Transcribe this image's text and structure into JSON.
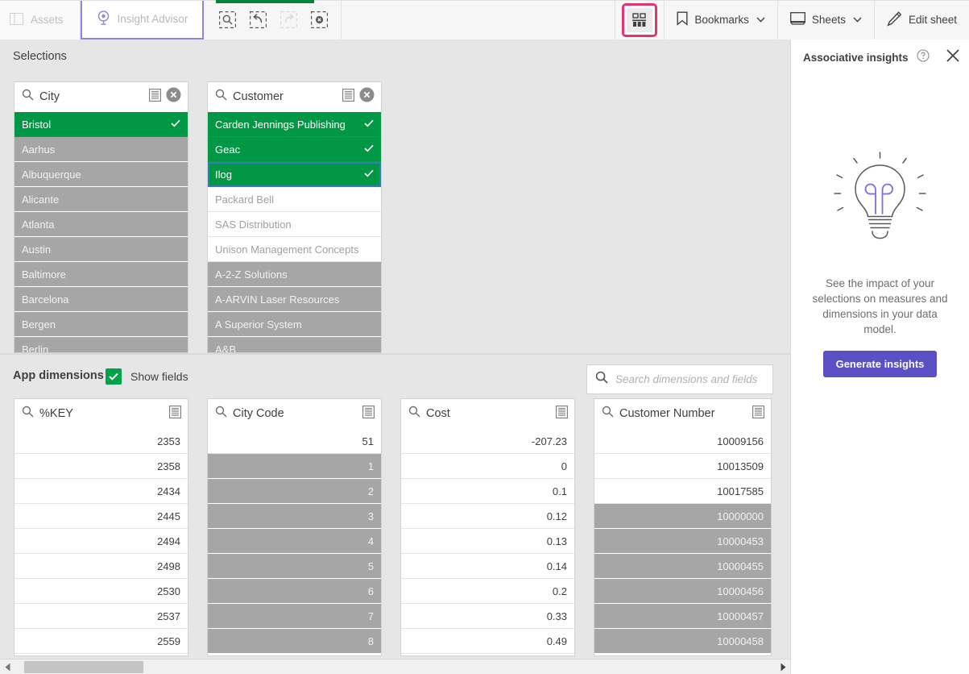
{
  "toolbar": {
    "assets_label": "Assets",
    "insight_advisor_label": "Insight Advisor",
    "icons": [
      "selection-search-icon",
      "step-back-icon",
      "step-forward-icon",
      "clear-all-selections-icon"
    ],
    "associative_insights_label": "Associative insights toggle",
    "bookmarks_label": "Bookmarks",
    "sheets_label": "Sheets",
    "edit_sheet_label": "Edit sheet",
    "chevron": "⌄",
    "highlight_color": "#e6336b",
    "accent_green": "#00873d",
    "insight_tab_border": "#8e86d6"
  },
  "selections": {
    "title": "Selections",
    "colors": {
      "selected": "#009845",
      "excluded": "#a6a6a6",
      "focus": "#3b7ab5"
    },
    "listboxes": [
      {
        "field": "City",
        "has_clear": true,
        "align": "left",
        "rows": [
          {
            "value": "Bristol",
            "state": "selected",
            "check": true
          },
          {
            "value": "Aarhus",
            "state": "excluded"
          },
          {
            "value": "Albuquerque",
            "state": "excluded"
          },
          {
            "value": "Alicante",
            "state": "excluded"
          },
          {
            "value": "Atlanta",
            "state": "excluded"
          },
          {
            "value": "Austin",
            "state": "excluded"
          },
          {
            "value": "Baltimore",
            "state": "excluded"
          },
          {
            "value": "Barcelona",
            "state": "excluded"
          },
          {
            "value": "Bergen",
            "state": "excluded"
          },
          {
            "value": "Berlin",
            "state": "excluded"
          }
        ]
      },
      {
        "field": "Customer",
        "has_clear": true,
        "align": "left",
        "rows": [
          {
            "value": "Carden Jennings Publishing",
            "state": "selected",
            "check": true
          },
          {
            "value": "Geac",
            "state": "selected",
            "check": true
          },
          {
            "value": "Ilog",
            "state": "selected",
            "check": true,
            "focused": true
          },
          {
            "value": "Packard Bell",
            "state": "alt"
          },
          {
            "value": "SAS Distribution",
            "state": "alt"
          },
          {
            "value": "Unison Management Concepts",
            "state": "alt"
          },
          {
            "value": "A-2-Z Solutions",
            "state": "excluded"
          },
          {
            "value": "A-ARVIN Laser Resources",
            "state": "excluded"
          },
          {
            "value": "A Superior System",
            "state": "excluded"
          },
          {
            "value": "A&B",
            "state": "excluded"
          }
        ]
      }
    ]
  },
  "app_dimensions": {
    "title": "App dimensions",
    "show_fields_label": "Show fields",
    "show_fields_checked": true,
    "search_placeholder": "Search dimensions and fields",
    "search_value": "",
    "listboxes": [
      {
        "field": "%KEY",
        "has_clear": false,
        "align": "right",
        "rows": [
          {
            "value": "2353",
            "state": "possible"
          },
          {
            "value": "2358",
            "state": "possible"
          },
          {
            "value": "2434",
            "state": "possible"
          },
          {
            "value": "2445",
            "state": "possible"
          },
          {
            "value": "2494",
            "state": "possible"
          },
          {
            "value": "2498",
            "state": "possible"
          },
          {
            "value": "2530",
            "state": "possible"
          },
          {
            "value": "2537",
            "state": "possible"
          },
          {
            "value": "2559",
            "state": "possible"
          }
        ]
      },
      {
        "field": "City Code",
        "has_clear": false,
        "align": "right",
        "rows": [
          {
            "value": "51",
            "state": "possible"
          },
          {
            "value": "1",
            "state": "excluded"
          },
          {
            "value": "2",
            "state": "excluded"
          },
          {
            "value": "3",
            "state": "excluded"
          },
          {
            "value": "4",
            "state": "excluded"
          },
          {
            "value": "5",
            "state": "excluded"
          },
          {
            "value": "6",
            "state": "excluded"
          },
          {
            "value": "7",
            "state": "excluded"
          },
          {
            "value": "8",
            "state": "excluded"
          }
        ]
      },
      {
        "field": "Cost",
        "has_clear": false,
        "align": "right",
        "rows": [
          {
            "value": "-207.23",
            "state": "possible"
          },
          {
            "value": "0",
            "state": "possible"
          },
          {
            "value": "0.1",
            "state": "possible"
          },
          {
            "value": "0.12",
            "state": "possible"
          },
          {
            "value": "0.13",
            "state": "possible"
          },
          {
            "value": "0.14",
            "state": "possible"
          },
          {
            "value": "0.2",
            "state": "possible"
          },
          {
            "value": "0.33",
            "state": "possible"
          },
          {
            "value": "0.49",
            "state": "possible"
          }
        ]
      },
      {
        "field": "Customer Number",
        "has_clear": false,
        "align": "right",
        "rows": [
          {
            "value": "10009156",
            "state": "possible"
          },
          {
            "value": "10013509",
            "state": "possible"
          },
          {
            "value": "10017585",
            "state": "possible"
          },
          {
            "value": "10000000",
            "state": "excluded"
          },
          {
            "value": "10000453",
            "state": "excluded"
          },
          {
            "value": "10000455",
            "state": "excluded"
          },
          {
            "value": "10000456",
            "state": "excluded"
          },
          {
            "value": "10000457",
            "state": "excluded"
          },
          {
            "value": "10000458",
            "state": "excluded"
          }
        ]
      }
    ]
  },
  "associative_insights": {
    "title": "Associative insights",
    "help_icon": "help-circle-icon",
    "close_icon": "close-icon",
    "illustration": "lightbulb-illustration",
    "description": "See the impact of your selections on measures and dimensions in your data model.",
    "button_label": "Generate insights",
    "button_color": "#5b4fc4"
  },
  "scrollbar": {
    "left_arrow": "◀",
    "right_arrow": "▶"
  }
}
